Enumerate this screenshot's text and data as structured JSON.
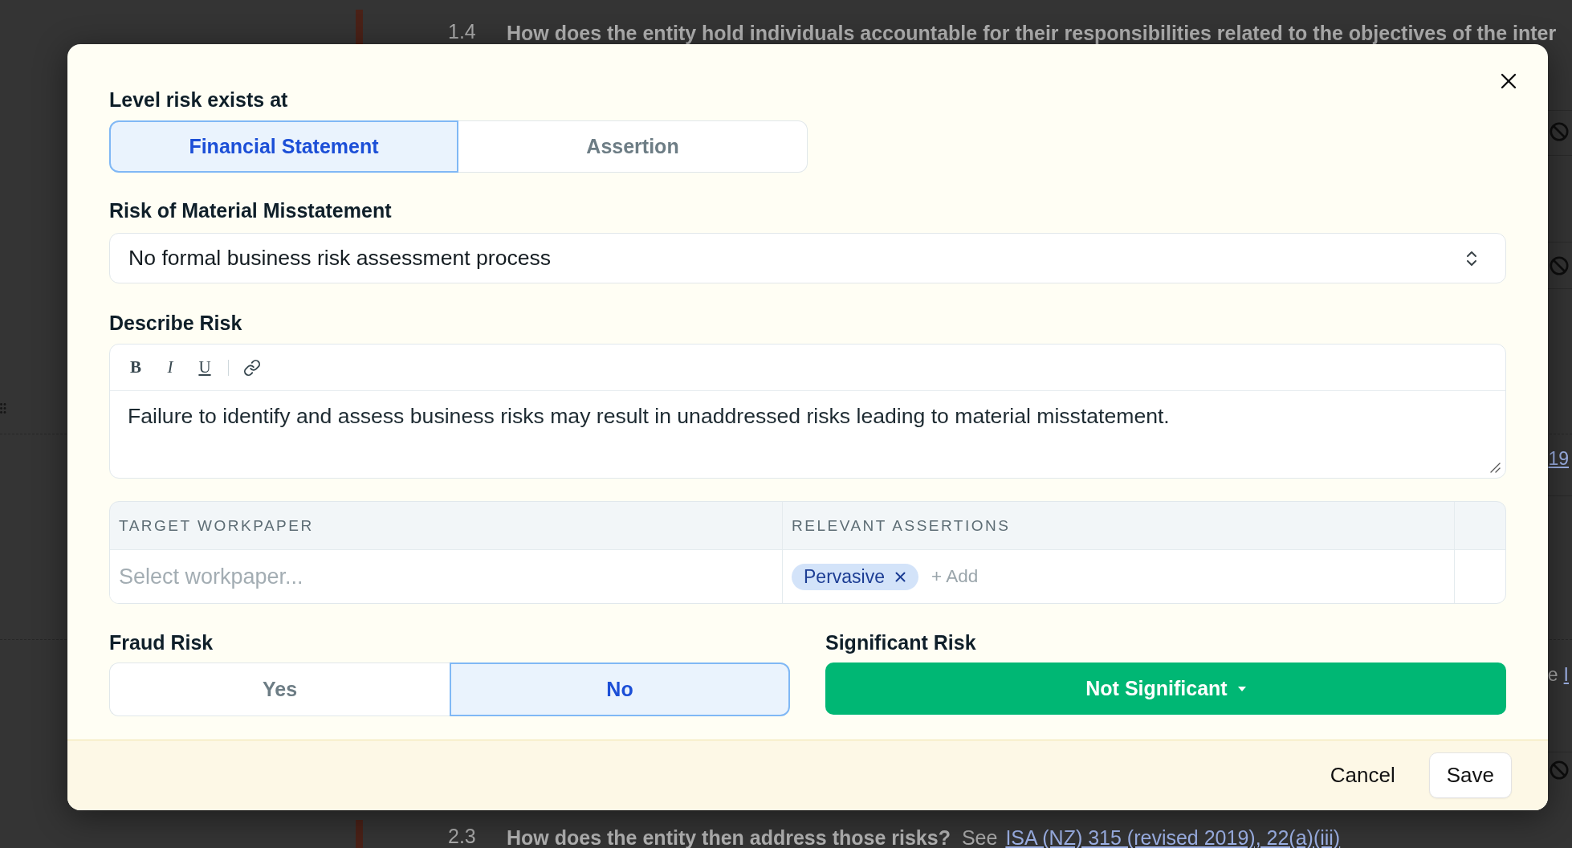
{
  "background": {
    "top_question": {
      "number": "1.4",
      "text": "How does the entity hold individuals accountable for their responsibilities related to the objectives of the inter"
    },
    "margin_items": [
      {
        "kind": "blocked"
      },
      {
        "kind": "blocked"
      },
      {
        "kind": "link",
        "text": "19"
      },
      {
        "kind": "text_link",
        "text": "e",
        "link": "I"
      },
      {
        "kind": "blocked"
      }
    ],
    "bottom_question": {
      "number": "2.3",
      "text": "How does the entity then address those risks?",
      "note": "See",
      "link": "ISA (NZ) 315 (revised 2019), 22(a)(iii)"
    }
  },
  "dialog": {
    "level": {
      "label": "Level risk exists at",
      "options": [
        {
          "label": "Financial Statement",
          "selected": true
        },
        {
          "label": "Assertion",
          "selected": false
        }
      ]
    },
    "risk": {
      "label": "Risk of Material Misstatement",
      "value": "No formal business risk assessment process"
    },
    "description": {
      "label": "Describe Risk",
      "toolbar": [
        {
          "kind": "bold",
          "glyph": "B"
        },
        {
          "kind": "italic",
          "glyph": "I"
        },
        {
          "kind": "underline",
          "glyph": "U"
        },
        {
          "kind": "link"
        }
      ],
      "value": "Failure to identify and assess business risks may result in unaddressed risks leading to material misstatement."
    },
    "assertions_table": {
      "columns": [
        "TARGET WORKPAPER",
        "RELEVANT ASSERTIONS"
      ],
      "workpaper": {
        "placeholder": "Select workpaper..."
      },
      "assertions": [
        {
          "label": "Pervasive"
        }
      ],
      "add_label": "+ Add"
    },
    "fraud_risk": {
      "label": "Fraud Risk",
      "options": [
        {
          "label": "Yes",
          "selected": false
        },
        {
          "label": "No",
          "selected": true
        }
      ]
    },
    "significant_risk": {
      "label": "Significant Risk",
      "value": "Not Significant"
    },
    "footer": {
      "buttons": [
        {
          "label": "Cancel",
          "kind": "text"
        },
        {
          "label": "Save",
          "kind": "outlined"
        }
      ]
    }
  }
}
